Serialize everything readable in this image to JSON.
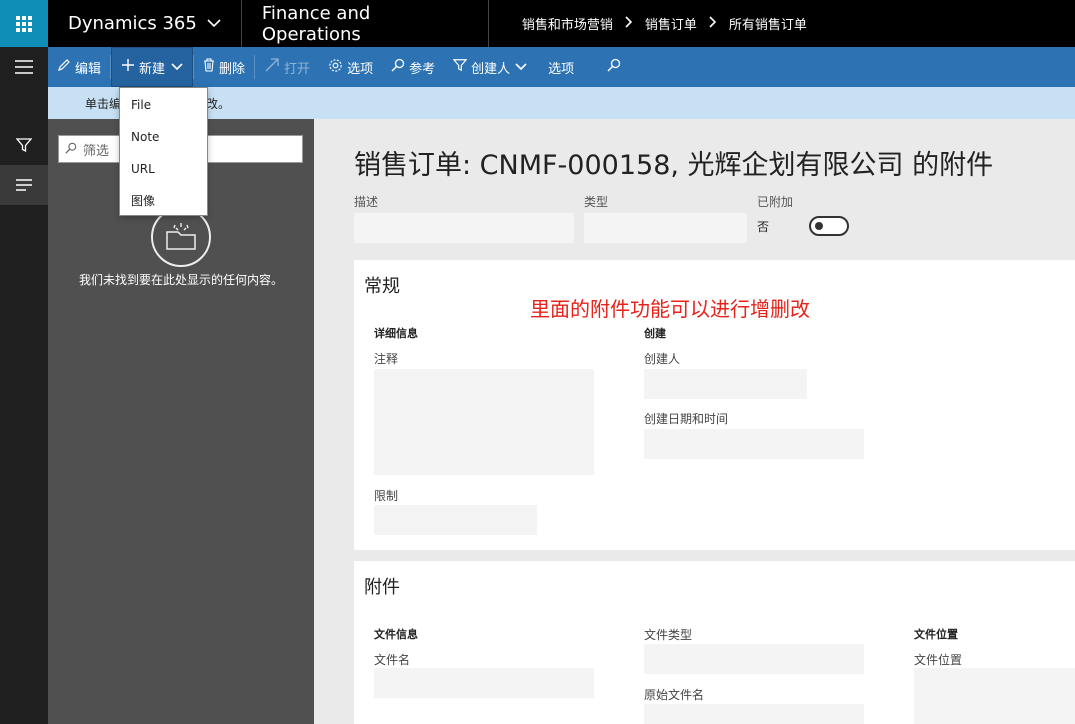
{
  "topbar": {
    "app_name": "Dynamics 365",
    "module": "Finance and Operations",
    "breadcrumbs": [
      "销售和市场营销",
      "销售订单",
      "所有销售订单"
    ]
  },
  "actions": {
    "edit": "编辑",
    "new": "新建",
    "delete": "删除",
    "open": "打开",
    "options_icon_label": "选项",
    "reference": "参考",
    "created_by": "创建人",
    "options": "选项"
  },
  "dropdown": {
    "items": [
      "File",
      "Note",
      "URL",
      "图像"
    ]
  },
  "infobar": {
    "text": "单击编辑以进行更改。",
    "visible_prefix": "单击编",
    "visible_suffix": "改。"
  },
  "listpane": {
    "filter_placeholder": "筛选",
    "empty_text": "我们未找到要在此处显示的任何内容。"
  },
  "main": {
    "title": "销售订单: CNMF-000158, 光辉企划有限公司 的附件",
    "header": {
      "description_label": "描述",
      "type_label": "类型",
      "attached_label": "已附加",
      "attached_value": "否"
    },
    "general": {
      "title": "常规",
      "annotation": "里面的附件功能可以进行增删改",
      "details_group": "详细信息",
      "notes_label": "注释",
      "restriction_label": "限制",
      "create_group": "创建",
      "created_by_label": "创建人",
      "created_datetime_label": "创建日期和时间"
    },
    "attachments": {
      "title": "附件",
      "file_info_group": "文件信息",
      "file_name_label": "文件名",
      "file_type_label": "文件类型",
      "original_file_name_label": "原始文件名",
      "file_location_group": "文件位置",
      "file_location_label": "文件位置"
    }
  },
  "colors": {
    "topbar": "#000000",
    "waffle": "#0f8fb8",
    "actionbar": "#2d73b4",
    "infobar": "#c7e0f4",
    "listpane": "#505050",
    "annotation": "#e5231b"
  }
}
